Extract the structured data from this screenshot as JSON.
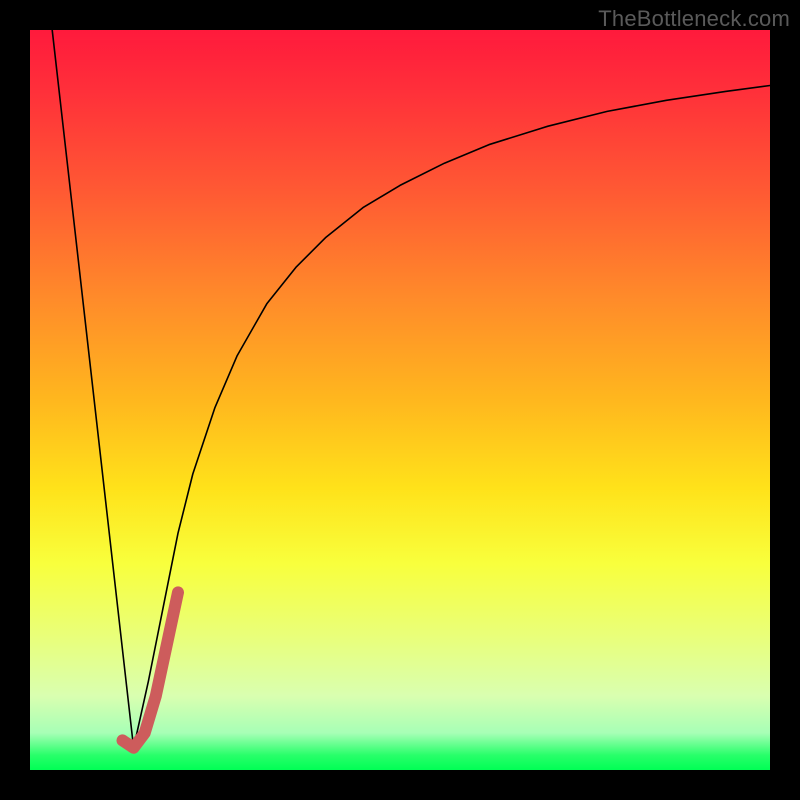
{
  "watermark": "TheBottleneck.com",
  "colors": {
    "curve_stroke": "#000000",
    "marker_stroke": "#cd5c5c",
    "frame_bg": "#000000"
  },
  "chart_data": {
    "type": "line",
    "title": "",
    "xlabel": "",
    "ylabel": "",
    "xlim": [
      0,
      100
    ],
    "ylim": [
      0,
      100
    ],
    "series": [
      {
        "name": "left-descent",
        "x": [
          3,
          14
        ],
        "y": [
          100,
          3
        ],
        "stroke_width": 1.6
      },
      {
        "name": "right-ascent",
        "x": [
          14,
          16,
          18,
          20,
          22,
          25,
          28,
          32,
          36,
          40,
          45,
          50,
          56,
          62,
          70,
          78,
          86,
          94,
          100
        ],
        "y": [
          3,
          12,
          22,
          32,
          40,
          49,
          56,
          63,
          68,
          72,
          76,
          79,
          82,
          84.5,
          87,
          89,
          90.5,
          91.7,
          92.5
        ],
        "stroke_width": 1.6
      },
      {
        "name": "marker-j",
        "x": [
          12.5,
          14,
          15.5,
          17,
          18.5,
          20
        ],
        "y": [
          4,
          3,
          5,
          10,
          17,
          24
        ],
        "stroke_width": 12
      }
    ]
  }
}
